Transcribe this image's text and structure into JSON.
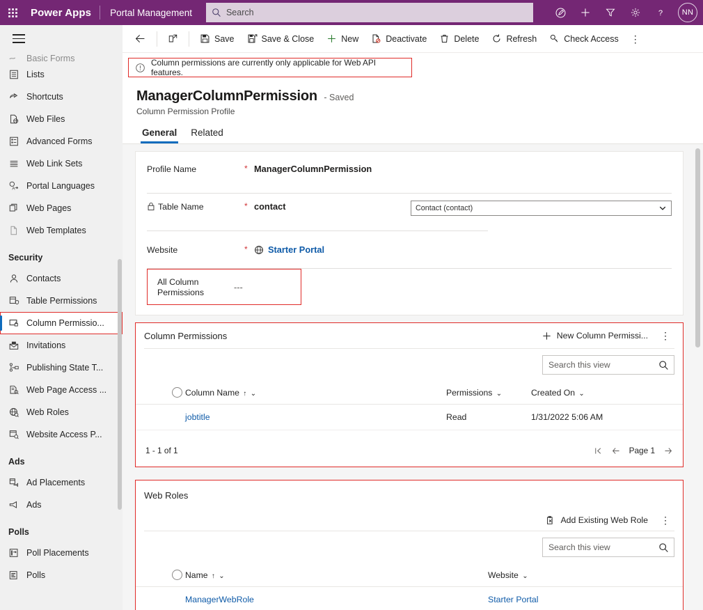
{
  "topbar": {
    "waffle_label": "app-launcher",
    "brand": "Power Apps",
    "app_name": "Portal Management",
    "search_placeholder": "Search",
    "search_value": "",
    "icons": [
      "dictation-pen-icon",
      "add-icon",
      "filter-icon",
      "settings-gear-icon",
      "help-question-icon"
    ],
    "avatar_initials": "NN",
    "accent_color": "#742774",
    "search_bg": "#dccfdd"
  },
  "sidebar": {
    "clipped_item": {
      "label": "Basic Forms",
      "icon": "basic-forms-icon"
    },
    "items": [
      {
        "label": "Lists",
        "icon": "list-icon"
      },
      {
        "label": "Shortcuts",
        "icon": "shortcut-icon"
      },
      {
        "label": "Web Files",
        "icon": "web-file-icon"
      },
      {
        "label": "Advanced Forms",
        "icon": "advanced-form-icon"
      },
      {
        "label": "Web Link Sets",
        "icon": "web-link-sets-icon"
      },
      {
        "label": "Portal Languages",
        "icon": "portal-languages-icon"
      },
      {
        "label": "Web Pages",
        "icon": "web-pages-icon"
      },
      {
        "label": "Web Templates",
        "icon": "web-template-icon"
      }
    ],
    "groups": [
      {
        "title": "Security",
        "items": [
          {
            "label": "Contacts",
            "icon": "contact-person-icon",
            "selected": false
          },
          {
            "label": "Table Permissions",
            "icon": "table-permissions-icon",
            "selected": false
          },
          {
            "label": "Column Permissio...",
            "icon": "column-permissions-icon",
            "selected": true
          },
          {
            "label": "Invitations",
            "icon": "invitation-icon",
            "selected": false
          },
          {
            "label": "Publishing State T...",
            "icon": "publishing-state-icon",
            "selected": false
          },
          {
            "label": "Web Page Access ...",
            "icon": "web-page-access-icon",
            "selected": false
          },
          {
            "label": "Web Roles",
            "icon": "web-roles-icon",
            "selected": false
          },
          {
            "label": "Website Access P...",
            "icon": "website-access-icon",
            "selected": false
          }
        ]
      },
      {
        "title": "Ads",
        "items": [
          {
            "label": "Ad Placements",
            "icon": "ad-placement-icon",
            "selected": false
          },
          {
            "label": "Ads",
            "icon": "ad-icon",
            "selected": false
          }
        ]
      },
      {
        "title": "Polls",
        "items": [
          {
            "label": "Poll Placements",
            "icon": "poll-placement-icon",
            "selected": false
          },
          {
            "label": "Polls",
            "icon": "poll-icon",
            "selected": false
          }
        ]
      }
    ],
    "selection_accent": "#0f6cbd",
    "highlight_color": "#e02b28"
  },
  "commandbar": {
    "back_label": "back-arrow",
    "popout_label": "open-in-new-window",
    "buttons": [
      {
        "label": "Save",
        "icon": "save-disk-icon"
      },
      {
        "label": "Save & Close",
        "icon": "save-and-close-icon"
      },
      {
        "label": "New",
        "icon": "plus-icon"
      },
      {
        "label": "Deactivate",
        "icon": "deactivate-icon"
      },
      {
        "label": "Delete",
        "icon": "trash-icon"
      },
      {
        "label": "Refresh",
        "icon": "refresh-icon"
      },
      {
        "label": "Check Access",
        "icon": "check-access-key-icon"
      }
    ],
    "overflow_label": "more-commands"
  },
  "notification": {
    "icon": "info-circle-icon",
    "text": "Column permissions are currently only applicable for Web API features.",
    "border_color": "#e02b28"
  },
  "record": {
    "title": "ManagerColumnPermission",
    "saved_status": "- Saved",
    "subtitle": "Column Permission Profile"
  },
  "tabs": [
    {
      "label": "General",
      "active": true
    },
    {
      "label": "Related",
      "active": false
    }
  ],
  "form": {
    "fields": [
      {
        "label": "Profile Name",
        "required": "*",
        "value": "ManagerColumnPermission",
        "locked": false
      },
      {
        "label": "Table Name",
        "required": "*",
        "value": "contact",
        "locked": true,
        "lookup_value": "Contact (contact)"
      },
      {
        "label": "Website",
        "required": "*",
        "value": "Starter Portal",
        "locked": false,
        "is_link": true,
        "icon": "globe-icon"
      }
    ],
    "all_column_permissions": {
      "label": "All Column Permissions",
      "value": "---"
    }
  },
  "column_permissions_grid": {
    "title": "Column Permissions",
    "new_button": {
      "label": "New Column Permissi...",
      "icon": "plus-icon"
    },
    "overflow_label": "more-grid-commands",
    "search_placeholder": "Search this view",
    "search_value": "",
    "columns": [
      {
        "label": "Column Name",
        "sorted": "↑"
      },
      {
        "label": "Permissions",
        "sorted": ""
      },
      {
        "label": "Created On",
        "sorted": ""
      }
    ],
    "rows": [
      {
        "column_name": "jobtitle",
        "permissions": "Read",
        "created_on": "1/31/2022 5:06 AM"
      }
    ],
    "footer_count": "1 - 1 of 1",
    "page_label": "Page 1"
  },
  "web_roles_grid": {
    "title": "Web Roles",
    "add_button": {
      "label": "Add Existing Web Role",
      "icon": "add-existing-icon"
    },
    "overflow_label": "more-grid-commands",
    "search_placeholder": "Search this view",
    "search_value": "",
    "columns": [
      {
        "label": "Name",
        "sorted": "↑"
      },
      {
        "label": "Website",
        "sorted": ""
      }
    ],
    "rows": [
      {
        "name": "ManagerWebRole",
        "website": "Starter Portal"
      }
    ]
  }
}
